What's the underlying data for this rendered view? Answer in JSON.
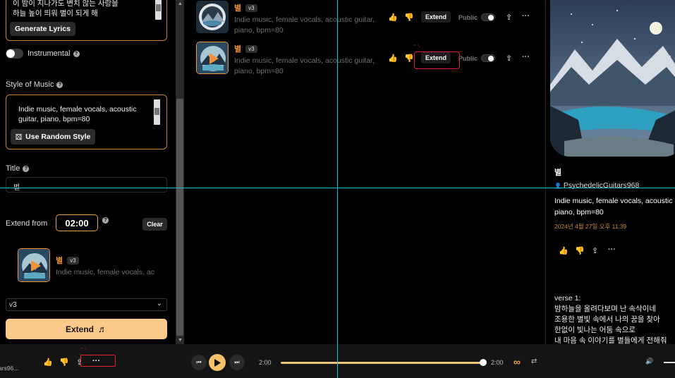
{
  "create_panel": {
    "lyrics_lines": [
      "이 밤이 지나가도 변치 않는 사랑을",
      "하늘 높이 띄워 별이 되게 해"
    ],
    "generate_lyrics_label": "Generate Lyrics",
    "instrumental_label": "Instrumental",
    "style_label": "Style of Music",
    "style_lines": [
      "Indie music, female vocals, acoustic",
      "guitar, piano, bpm=80"
    ],
    "random_style_label": "Use Random Style",
    "title_label": "Title",
    "title_value": "별",
    "extend_from_label": "Extend from",
    "extend_time": "02:00",
    "clear_label": "Clear",
    "extend_song": {
      "title": "별",
      "version": "v3",
      "desc": "Indie music, female vocals, ac"
    },
    "model_select": "v3",
    "extend_button_label": "Extend",
    "music_note_icon": "♬"
  },
  "song_list": [
    {
      "title": "별",
      "version": "v3",
      "desc_lines": [
        "Indie music, female vocals, acoustic guitar,",
        "piano, bpm=80"
      ],
      "extend_label": "Extend",
      "public_label": "Public"
    },
    {
      "title": "별",
      "version": "v3",
      "desc_lines": [
        "Indie music, female vocals, acoustic guitar,",
        "piano, bpm=80"
      ],
      "extend_label": "Extend",
      "public_label": "Public"
    }
  ],
  "detail_panel": {
    "title": "별",
    "user": "PsychedelicGuitars968",
    "desc_lines": [
      "Indie music, female vocals, acoustic g",
      "piano, bpm=80"
    ],
    "date": "2024년 4월 27일 오후 11:39",
    "lyrics_lines": [
      "verse 1:",
      "밤하늘을 올려다보며 난 속삭이네",
      "조용한 별빛 속에서 나의 꿈을 찾아",
      "한없이 빛나는 어둠 속으로",
      "내 마음 속 이야기를 별들에게 전해줘"
    ]
  },
  "player": {
    "user_partial": "ars96...",
    "current_time": "2:00",
    "total_time": "2:00",
    "progress": 1.0,
    "loop_icon": "∞",
    "shuffle_icon": "⇄",
    "volume_icon": "🔊"
  },
  "icons": {
    "like": "👍",
    "dislike": "👎",
    "share": "⇪",
    "more": "···",
    "dice": "⚄",
    "person": "👤",
    "prev": "⏮",
    "next": "⏭"
  },
  "colors": {
    "accent_orange": "#f0923b",
    "border_orange": "#c8832b",
    "button_peach": "#fdc98a",
    "guide_cyan": "#18c0d0",
    "annotation_red": "#e0252a"
  }
}
